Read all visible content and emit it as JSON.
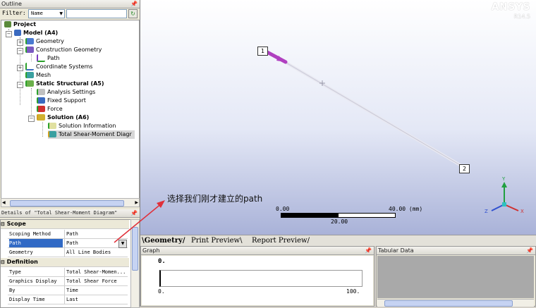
{
  "outline": {
    "title": "Outline",
    "pin": "p",
    "filter_label": "Filter:",
    "filter_value": "Name"
  },
  "tree": {
    "project": "Project",
    "model": "Model (A4)",
    "geometry": "Geometry",
    "construction_geometry": "Construction Geometry",
    "path": "Path",
    "coordinate_systems": "Coordinate Systems",
    "mesh": "Mesh",
    "static_structural": "Static Structural (A5)",
    "analysis_settings": "Analysis Settings",
    "fixed_support": "Fixed Support",
    "force": "Force",
    "solution": "Solution (A6)",
    "solution_information": "Solution Information",
    "total_shear_moment": "Total Shear-Moment Diagr"
  },
  "details": {
    "title": "Details of \"Total Shear-Moment Diagram\"",
    "scope_header": "Scope",
    "definition_header": "Definition",
    "rows": [
      {
        "key": "Scoping Method",
        "value": "Path"
      },
      {
        "key": "Path",
        "value": "Path"
      },
      {
        "key": "Geometry",
        "value": "All Line Bodies"
      },
      {
        "key": "Type",
        "value": "Total Shear-Momen..."
      },
      {
        "key": "Graphics Display",
        "value": "Total Shear Force"
      },
      {
        "key": "By",
        "value": "Time"
      },
      {
        "key": "Display Time",
        "value": "Last"
      }
    ]
  },
  "viewport": {
    "brand": "ANSYS",
    "version": "R14.5",
    "annotation": "选择我们刚才建立的path",
    "point1": "1",
    "point2": "2",
    "scale_min": "0.00",
    "scale_max": "40.00 (mm)",
    "scale_mid": "20.00",
    "axis_x": "X",
    "axis_y": "Y",
    "axis_z": "Z"
  },
  "tabs": [
    "Geometry",
    "Print Preview",
    "Report Preview"
  ],
  "graph": {
    "title": "Graph",
    "y_top": "0.",
    "x_min": "0.",
    "x_max": "100."
  },
  "tabular": {
    "title": "Tabular Data"
  },
  "colors": {
    "selected_row": "#316ac5",
    "arrow_annotation": "#e0303a",
    "path_arrow": "#b040c0"
  }
}
